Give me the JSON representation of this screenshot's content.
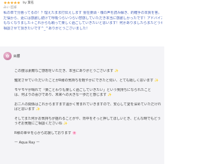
{
  "review": {
    "stars": "★★★★★",
    "user": "by 葉名",
    "sub": "みい 匠様",
    "lines": [
      "私の単で分悪ってるの！？理えたまま打伝えします 霊在要頭・魂の声を読み解き、的確手の本質を答。",
      "だ悩から、更には感謝し続けて呼吸つらいつらい悲感していただき本当に感謝しかったです！アドバイスも頂きモヤモヤ",
      "もなくなりました＋これからも頼って楽しく過ごしていきたいと思います！何かありましたらまたどうぞ",
      "相談させて頂きたいです^_^ありがとうございました！"
    ]
  },
  "reply": {
    "name": "R様",
    "avatar_glyph": "✿",
    "p1": [
      "この度は素敵なご感想をいただき、本当にありがとうございます ✨"
    ],
    "p2": [
      "鑑定させていただいたことがR様の気持ちを軽やかにできたと伺い、とても嬉しく思います ✨"
    ],
    "p3": [
      "モヤモヤが晴れて「楽ことわりも楽しく過ごしていきたい」という気持ちになられたこと",
      "は、何よりの喜びであり、未来への大きな一歩だと感じます ✨"
    ],
    "p4": [
      "お二人の関係はこれからますます温かく育まれていきますので、安心して愛を深めていただけれ",
      "ばと思います ✨"
    ],
    "p5": [
      "そしてまた何かお気持ちが揺れることがや、背中をそっと押してほしいとき、どんな時でもどうぞ",
      "うぞお気軽にご相談くださいね ✨"
    ],
    "p6": [
      "R様の幸せを心から応援しております 🌸"
    ],
    "sign": "ー Aqua Ray ー"
  }
}
